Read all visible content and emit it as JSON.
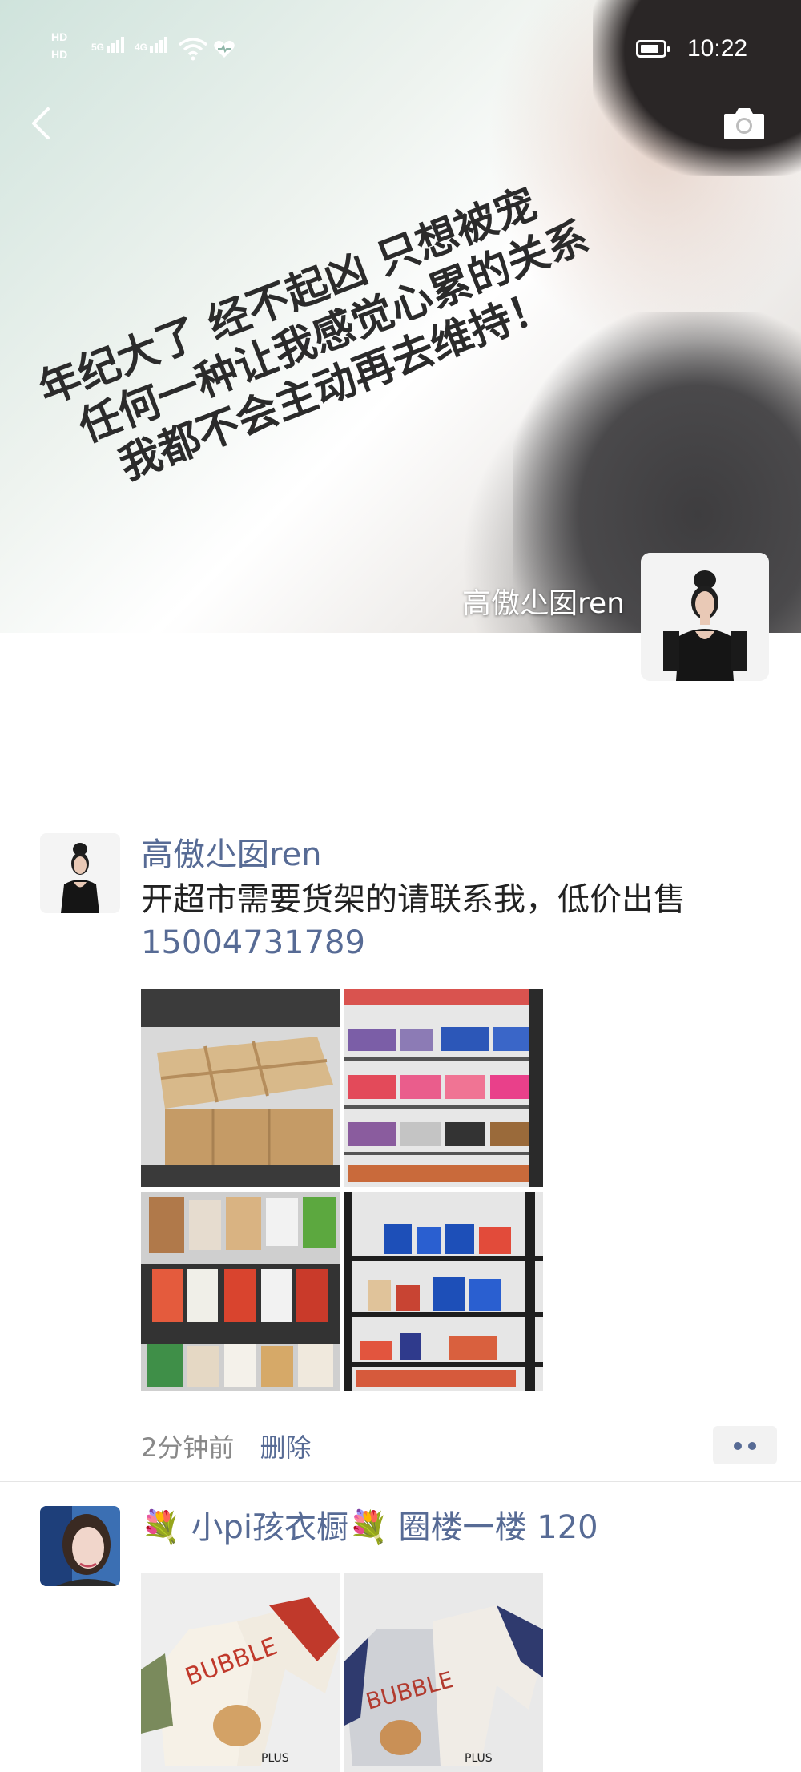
{
  "status_bar": {
    "hd1": "HD",
    "hd2": "HD",
    "net1": "5G",
    "net2": "4G",
    "time": "10:22"
  },
  "cover": {
    "poster_lines": [
      "年纪大了 经不起凶 只想被宠",
      "任何一种让我感觉心累的关系",
      "我都不会主动再去维持！"
    ],
    "owner_name": "高傲尐囡ren"
  },
  "icons": {
    "back": "back-arrow-icon",
    "camera": "camera-icon",
    "more": "more-dots-icon"
  },
  "posts": [
    {
      "username": "高傲尐囡ren",
      "text": "开超市需要货架的请联系我，低价出售",
      "phone": "15004731789",
      "time": "2分钟前",
      "delete_label": "删除",
      "images": [
        "wooden-bin-shelf-photo",
        "candy-shelf-photo",
        "snack-rack-photo",
        "metal-shelf-products-photo"
      ]
    },
    {
      "username": "💐 小pi孩衣橱💐 圈楼一楼 120",
      "images": [
        "kids-shirt-photo-1",
        "kids-shirt-photo-2"
      ]
    }
  ],
  "colors": {
    "link": "#576b95",
    "text": "#222222",
    "meta": "#888888"
  }
}
